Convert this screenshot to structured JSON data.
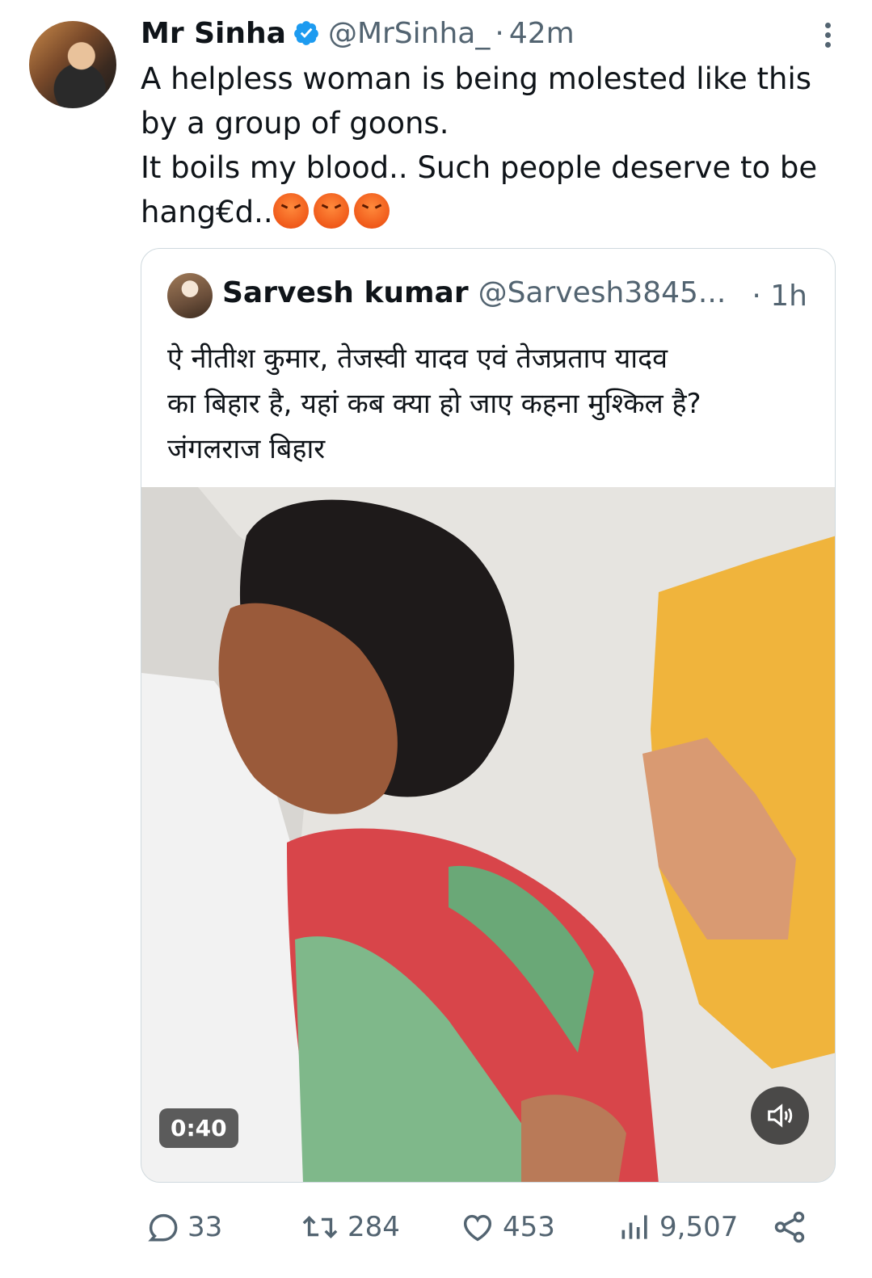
{
  "tweet": {
    "author_name": "Mr Sinha",
    "author_handle": "@MrSinha_",
    "separator": "·",
    "time": "42m",
    "text": "A helpless woman is being molested like this\nby a group of goons.\nIt boils my blood.. Such people deserve to be\nhang€d..",
    "emojis": [
      "angry-face",
      "angry-face",
      "angry-face"
    ]
  },
  "quote": {
    "author_name": "Sarvesh kumar",
    "author_handle": "@Sarvesh3845...",
    "time": "· 1h",
    "text": "ऐ नीतीश कुमार, तेजस्वी यादव एवं तेजप्रताप यादव\nका बिहार है, यहां कब क्या हो जाए कहना मुश्किल है?\nजंगलराज बिहार",
    "video_duration": "0:40"
  },
  "actions": {
    "replies": "33",
    "reposts": "284",
    "likes": "453",
    "views": "9,507"
  },
  "colors": {
    "text": "#0f1419",
    "secondary": "#536471",
    "verified": "#1d9bf0",
    "border": "#cfd9de"
  }
}
